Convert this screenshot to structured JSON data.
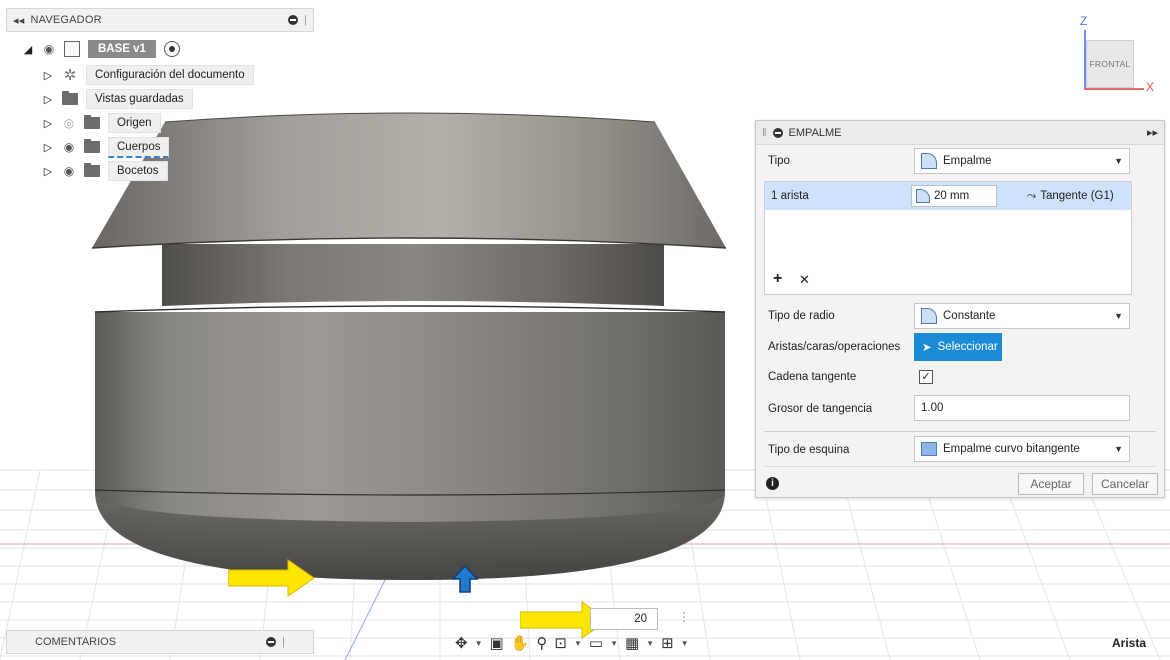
{
  "navigator": {
    "title": "NAVEGADOR",
    "root": {
      "name": "BASE v1"
    },
    "items": [
      {
        "label": "Configuración del documento",
        "icon": "gear-icon"
      },
      {
        "label": "Vistas guardadas",
        "icon": "folder-icon"
      },
      {
        "label": "Origen",
        "icon": "folder-icon",
        "hidden": true
      },
      {
        "label": "Cuerpos",
        "icon": "folder-icon"
      },
      {
        "label": "Bocetos",
        "icon": "folder-icon"
      }
    ]
  },
  "viewcube": {
    "face": "FRONTAL",
    "z_label": "Z",
    "x_label": "X"
  },
  "fillet_panel": {
    "title": "EMPALME",
    "type_label": "Tipo",
    "type_value": "Empalme",
    "selection": {
      "edges": "1 arista",
      "radius": "20 mm",
      "continuity": "Tangente (G1)"
    },
    "add_symbol": "+",
    "remove_symbol": "✕",
    "radius_type_label": "Tipo de radio",
    "radius_type_value": "Constante",
    "edges_label": "Aristas/caras/operaciones",
    "select_button": "Seleccionar",
    "tangent_chain_label": "Cadena tangente",
    "tangent_chain_checked": true,
    "tangency_weight_label": "Grosor de tangencia",
    "tangency_weight_value": "1.00",
    "corner_type_label": "Tipo de esquina",
    "corner_type_value": "Empalme curvo bitangente",
    "ok_label": "Aceptar",
    "cancel_label": "Cancelar"
  },
  "dimension_input": {
    "value": "20"
  },
  "comments": {
    "title": "COMENTARIOS"
  },
  "status_text": "Arista",
  "colors": {
    "accent_blue": "#1b8bd6",
    "selection_row": "#cfe2fb",
    "annotation_arrow": "#ffe600",
    "model_gray": "#7a7875"
  }
}
